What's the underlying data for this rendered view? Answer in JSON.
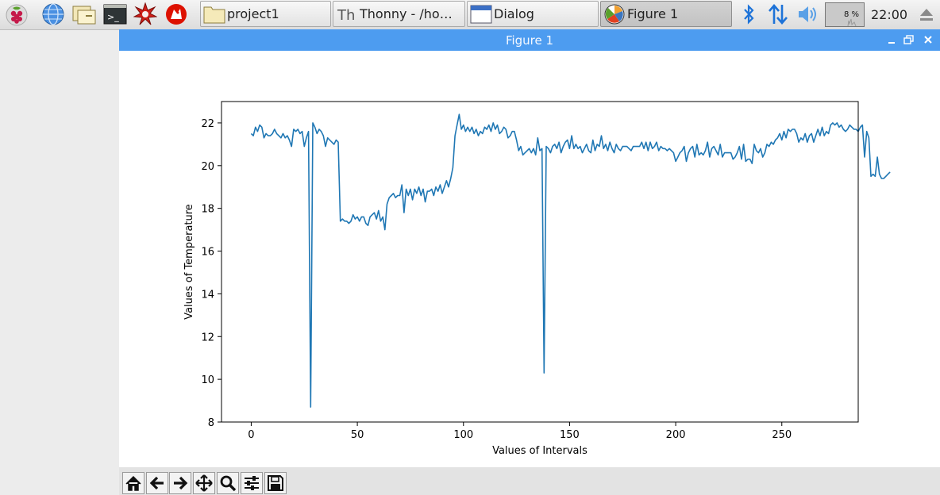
{
  "taskbar": {
    "tasks": [
      {
        "label": "project1",
        "icon": "folder-icon"
      },
      {
        "label": "Thonny  -  /home...",
        "icon": "thonny-icon"
      },
      {
        "label": "Dialog",
        "icon": "window-icon"
      },
      {
        "label": "Figure 1",
        "icon": "matplotlib-icon",
        "active": true
      }
    ],
    "cpu_usage": "8 %",
    "clock": "22:00"
  },
  "window": {
    "title": "Figure 1"
  },
  "toolbar": {
    "tools": [
      "home-icon",
      "back-icon",
      "forward-icon",
      "pan-icon",
      "zoom-icon",
      "configure-subplots-icon",
      "save-icon"
    ]
  },
  "chart_data": {
    "type": "line",
    "xlabel": "Values of Intervals",
    "ylabel": "Values of Temperature",
    "xlim": [
      -14,
      286
    ],
    "ylim": [
      8,
      23
    ],
    "xticks": [
      0,
      50,
      100,
      150,
      200,
      250
    ],
    "yticks": [
      8,
      10,
      12,
      14,
      16,
      18,
      20,
      22
    ],
    "line_color": "#1f77b4",
    "series": [
      {
        "values": [
          21.5,
          21.4,
          21.8,
          21.6,
          21.9,
          21.8,
          21.3,
          21.5,
          21.4,
          21.4,
          21.5,
          21.7,
          21.5,
          21.4,
          21.3,
          21.5,
          21.3,
          21.4,
          21.2,
          20.9,
          21.7,
          21.6,
          21.7,
          21.5,
          21.6,
          20.9,
          21.3,
          21.6,
          8.7,
          22.0,
          21.8,
          21.5,
          21.7,
          21.6,
          21.4,
          20.9,
          21.3,
          21.2,
          21.1,
          21.0,
          21.2,
          21.1,
          17.4,
          17.5,
          17.4,
          17.4,
          17.3,
          17.4,
          17.7,
          17.5,
          17.6,
          17.4,
          17.6,
          17.6,
          17.3,
          17.2,
          17.6,
          17.7,
          17.8,
          17.5,
          17.9,
          17.4,
          17.6,
          17.0,
          18.2,
          18.5,
          18.6,
          18.7,
          18.5,
          18.6,
          18.6,
          19.1,
          17.8,
          18.9,
          18.6,
          18.9,
          18.4,
          18.9,
          18.7,
          19.0,
          18.6,
          18.9,
          18.3,
          18.8,
          18.8,
          18.9,
          18.6,
          19.0,
          18.8,
          19.1,
          18.7,
          19.0,
          19.3,
          19.0,
          19.4,
          19.9,
          21.4,
          21.9,
          22.4,
          21.7,
          21.9,
          21.6,
          21.8,
          21.6,
          21.8,
          21.5,
          21.7,
          21.4,
          21.6,
          21.5,
          21.8,
          21.7,
          21.9,
          21.6,
          22.0,
          21.7,
          21.9,
          21.5,
          21.6,
          21.8,
          21.7,
          21.3,
          21.4,
          21.6,
          21.6,
          21.2,
          20.7,
          20.9,
          20.5,
          20.6,
          20.7,
          20.8,
          20.6,
          20.8,
          20.5,
          21.3,
          20.7,
          20.8,
          10.3,
          20.9,
          20.8,
          20.6,
          20.9,
          21.0,
          20.8,
          21.1,
          20.6,
          20.9,
          21.1,
          21.2,
          20.8,
          21.4,
          20.8,
          21.0,
          20.8,
          20.9,
          20.6,
          20.8,
          21.0,
          20.7,
          20.6,
          21.2,
          20.7,
          21.0,
          20.9,
          21.4,
          20.8,
          21.0,
          20.7,
          21.1,
          20.8,
          20.6,
          21.0,
          20.8,
          20.7,
          20.9,
          20.9,
          20.9,
          20.8,
          20.7,
          20.9,
          20.9,
          20.9,
          20.9,
          21.1,
          20.8,
          21.1,
          20.7,
          21.1,
          20.8,
          20.9,
          21.1,
          20.7,
          20.9,
          20.8,
          20.8,
          20.7,
          20.8,
          20.7,
          20.6,
          20.2,
          20.4,
          20.6,
          20.7,
          20.9,
          20.2,
          20.6,
          20.8,
          20.9,
          20.4,
          21.0,
          20.5,
          20.6,
          20.5,
          20.7,
          21.1,
          20.4,
          20.8,
          20.9,
          20.7,
          20.5,
          21.0,
          20.4,
          20.6,
          20.6,
          20.6,
          20.6,
          20.3,
          20.4,
          20.6,
          20.9,
          20.3,
          21.0,
          20.2,
          20.3,
          20.3,
          20.1,
          21.0,
          20.7,
          20.6,
          20.8,
          20.4,
          20.6,
          21.0,
          20.9,
          21.1,
          21.0,
          21.2,
          21.3,
          21.5,
          21.2,
          21.6,
          21.3,
          21.7,
          21.6,
          21.7,
          21.7,
          21.5,
          21.1,
          21.3,
          21.2,
          21.5,
          21.1,
          21.4,
          21.5,
          21.1,
          21.4,
          21.7,
          21.4,
          21.8,
          21.4,
          21.6,
          21.5,
          21.9,
          22.0,
          21.9,
          22.0,
          21.8,
          21.9,
          21.7,
          21.6,
          21.7,
          21.9,
          21.8,
          21.7,
          21.7,
          21.6,
          21.8,
          21.9,
          20.4,
          21.6,
          21.3,
          19.5,
          19.6,
          19.5,
          20.4,
          19.6,
          19.4,
          19.4,
          19.5,
          19.6,
          19.7
        ]
      }
    ]
  }
}
